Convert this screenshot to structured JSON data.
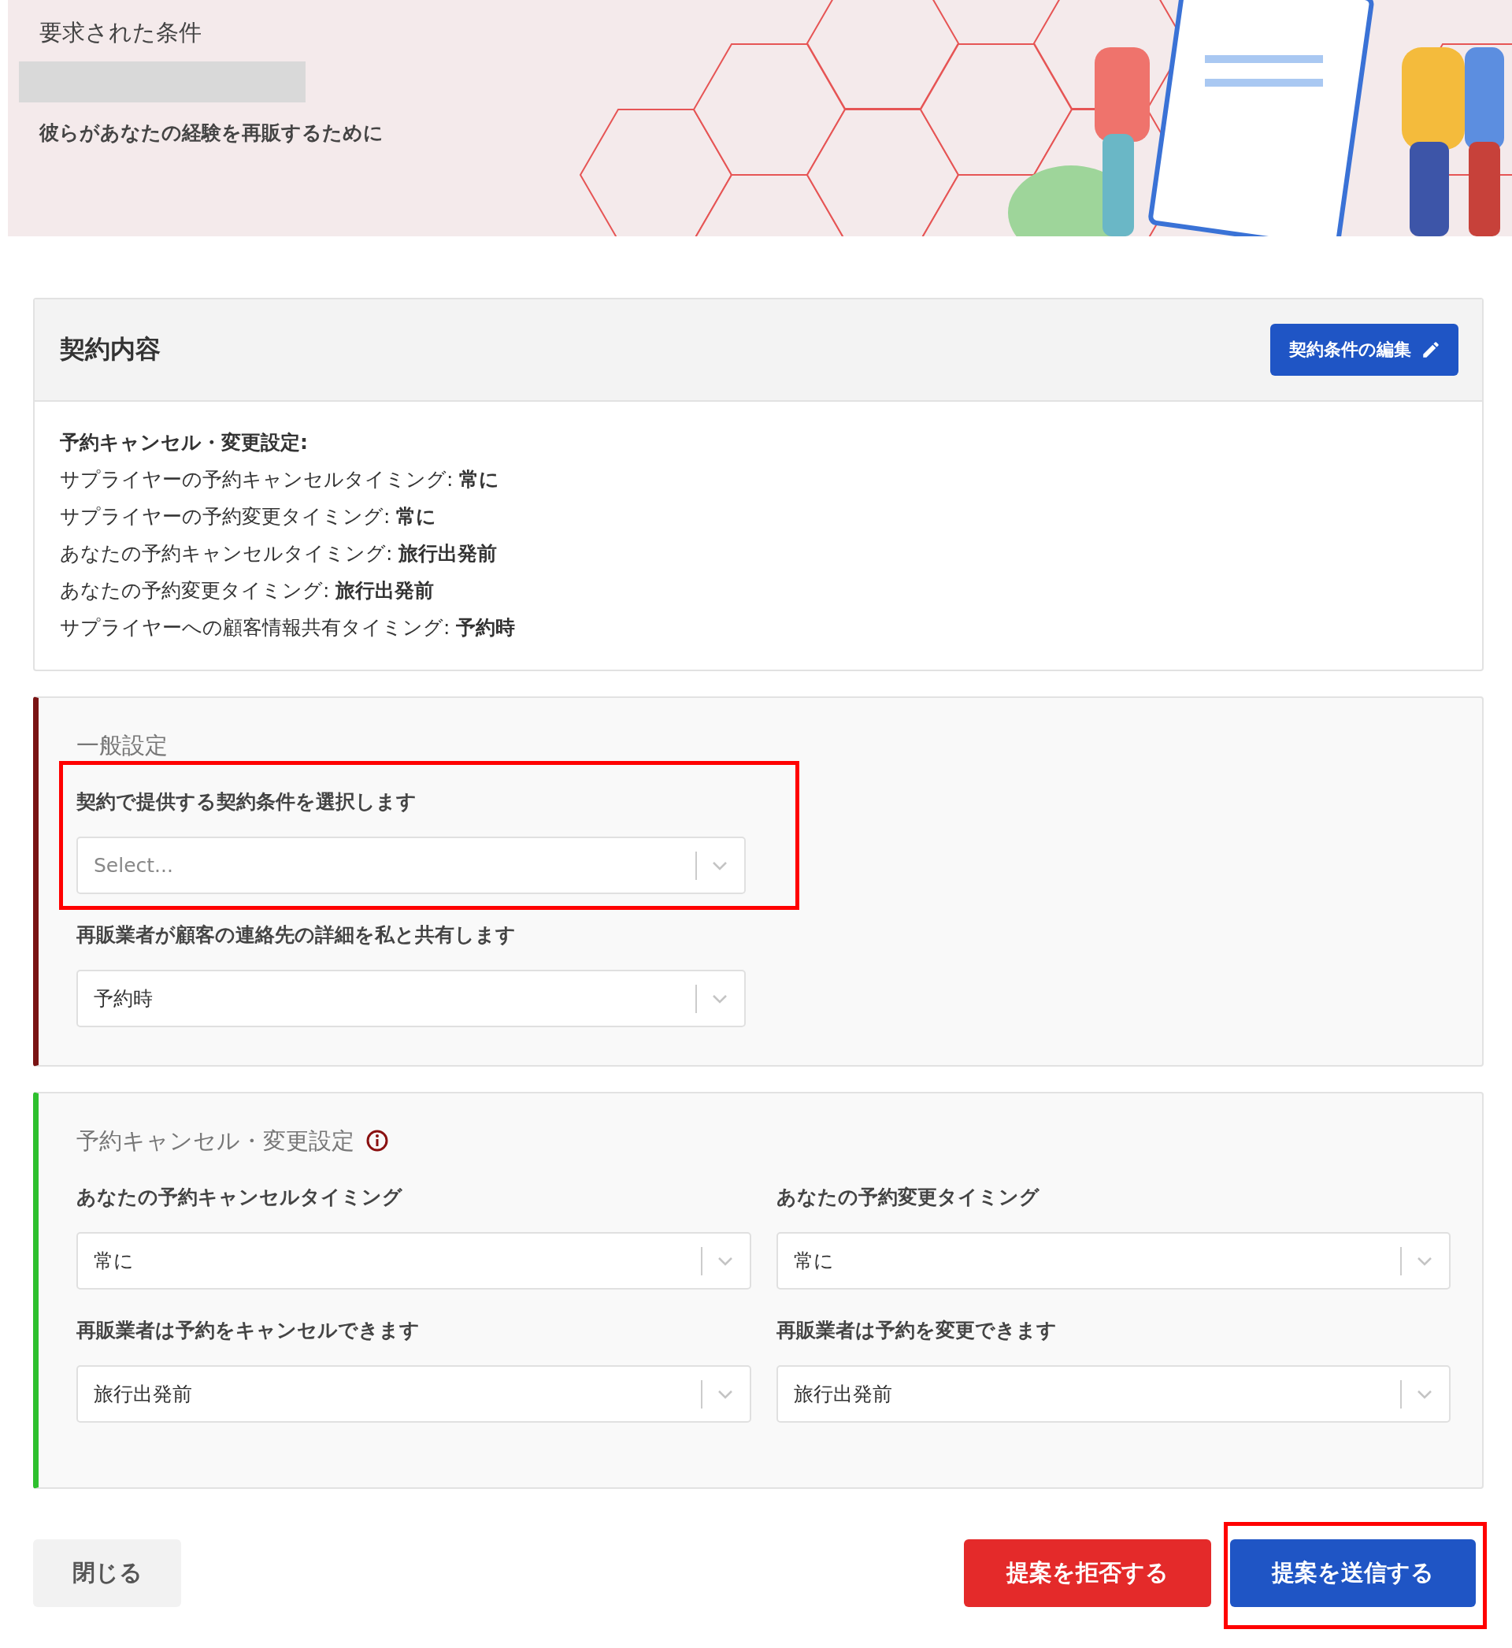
{
  "header": {
    "title": "要求された条件",
    "subtitle": "彼らがあなたの経験を再販するために"
  },
  "contract": {
    "title": "契約内容",
    "edit_button": "契約条件の編集",
    "heading": "予約キャンセル・変更設定:",
    "lines": [
      "サプライヤーの予約キャンセルタイミング: **常に**",
      "サプライヤーの予約変更タイミング: **常に**",
      "あなたの予約キャンセルタイミング: **旅行出発前**",
      "あなたの予約変更タイミング: **旅行出発前**",
      "サプライヤーへの顧客情報共有タイミング: **予約時**"
    ]
  },
  "sections": [
    {
      "title": "一般設定",
      "color": "#7a1414",
      "info": false,
      "fields": [
        {
          "label": "契約で提供する契約条件を選択します",
          "placeholder": "Select...",
          "highlighted": true
        },
        {
          "label": "再販業者が顧客の連絡先の詳細を私と共有します",
          "value": "予約時",
          "highlighted": false
        }
      ]
    },
    {
      "title": "予約キャンセル・変更設定",
      "color": "#2ec02e",
      "info": true,
      "fields": [
        {
          "label": "あなたの予約キャンセルタイミング",
          "value": "常に",
          "highlighted": false
        },
        {
          "label": "あなたの予約変更タイミング",
          "value": "常に",
          "highlighted": false
        },
        {
          "label": "再販業者は予約をキャンセルできます",
          "value": "旅行出発前",
          "highlighted": false
        },
        {
          "label": "再販業者は予約を変更できます",
          "value": "旅行出発前",
          "highlighted": false
        }
      ]
    }
  ],
  "buttons": [
    {
      "label": "閉じる",
      "kind": "secondary",
      "highlighted": false
    },
    {
      "label": "提案を拒否する",
      "kind": "danger",
      "highlighted": false
    },
    {
      "label": "提案を送信する",
      "kind": "primary",
      "highlighted": true
    }
  ]
}
